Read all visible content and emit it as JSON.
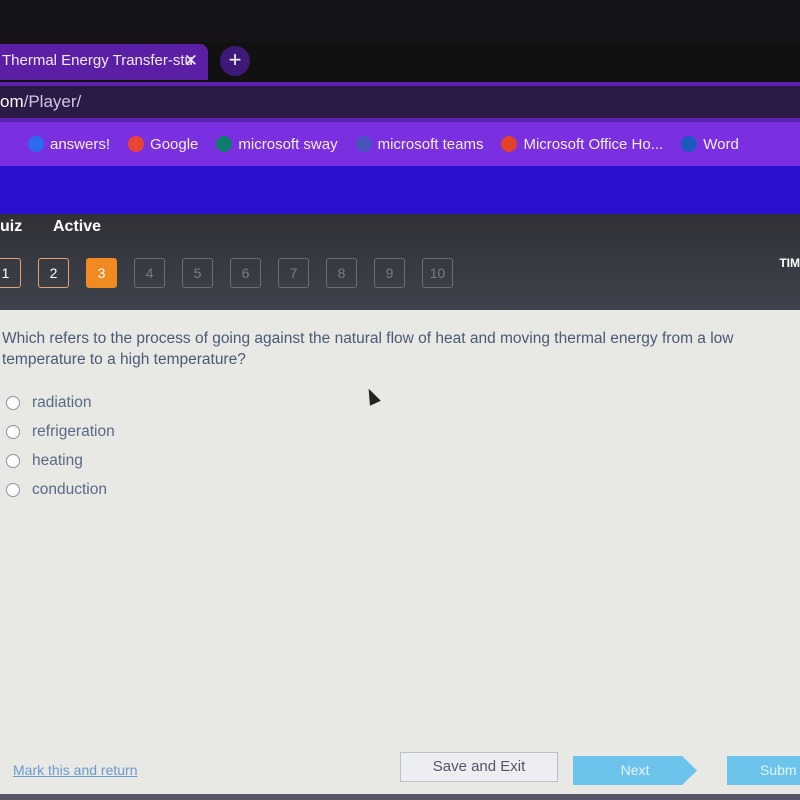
{
  "browser": {
    "tab_title": "Thermal Energy Transfer-stu",
    "close": "✕",
    "new_tab": "+",
    "url_prefix": "om",
    "url_path": "/Player/",
    "bookmarks": [
      {
        "label": "answers!",
        "color": "#2a6cf0"
      },
      {
        "label": "Google",
        "color": "#ea4335"
      },
      {
        "label": "microsoft sway",
        "color": "#0f7b6c"
      },
      {
        "label": "microsoft teams",
        "color": "#4b53bc"
      },
      {
        "label": "Microsoft Office Ho...",
        "color": "#e3412a"
      },
      {
        "label": "Word",
        "color": "#185abd"
      }
    ]
  },
  "quiz": {
    "title": "uiz",
    "status": "Active",
    "timer_label": "TIM",
    "questions": [
      "1",
      "2",
      "3",
      "4",
      "5",
      "6",
      "7",
      "8",
      "9",
      "10"
    ],
    "current": 3,
    "question": "Which refers to the process of going against the natural flow of heat and moving thermal energy from a low temperature to a high temperature?",
    "options": [
      "radiation",
      "refrigeration",
      "heating",
      "conduction"
    ]
  },
  "footer": {
    "mark": "Mark this and return",
    "save": "Save and Exit",
    "next": "Next",
    "submit": "Subm"
  }
}
